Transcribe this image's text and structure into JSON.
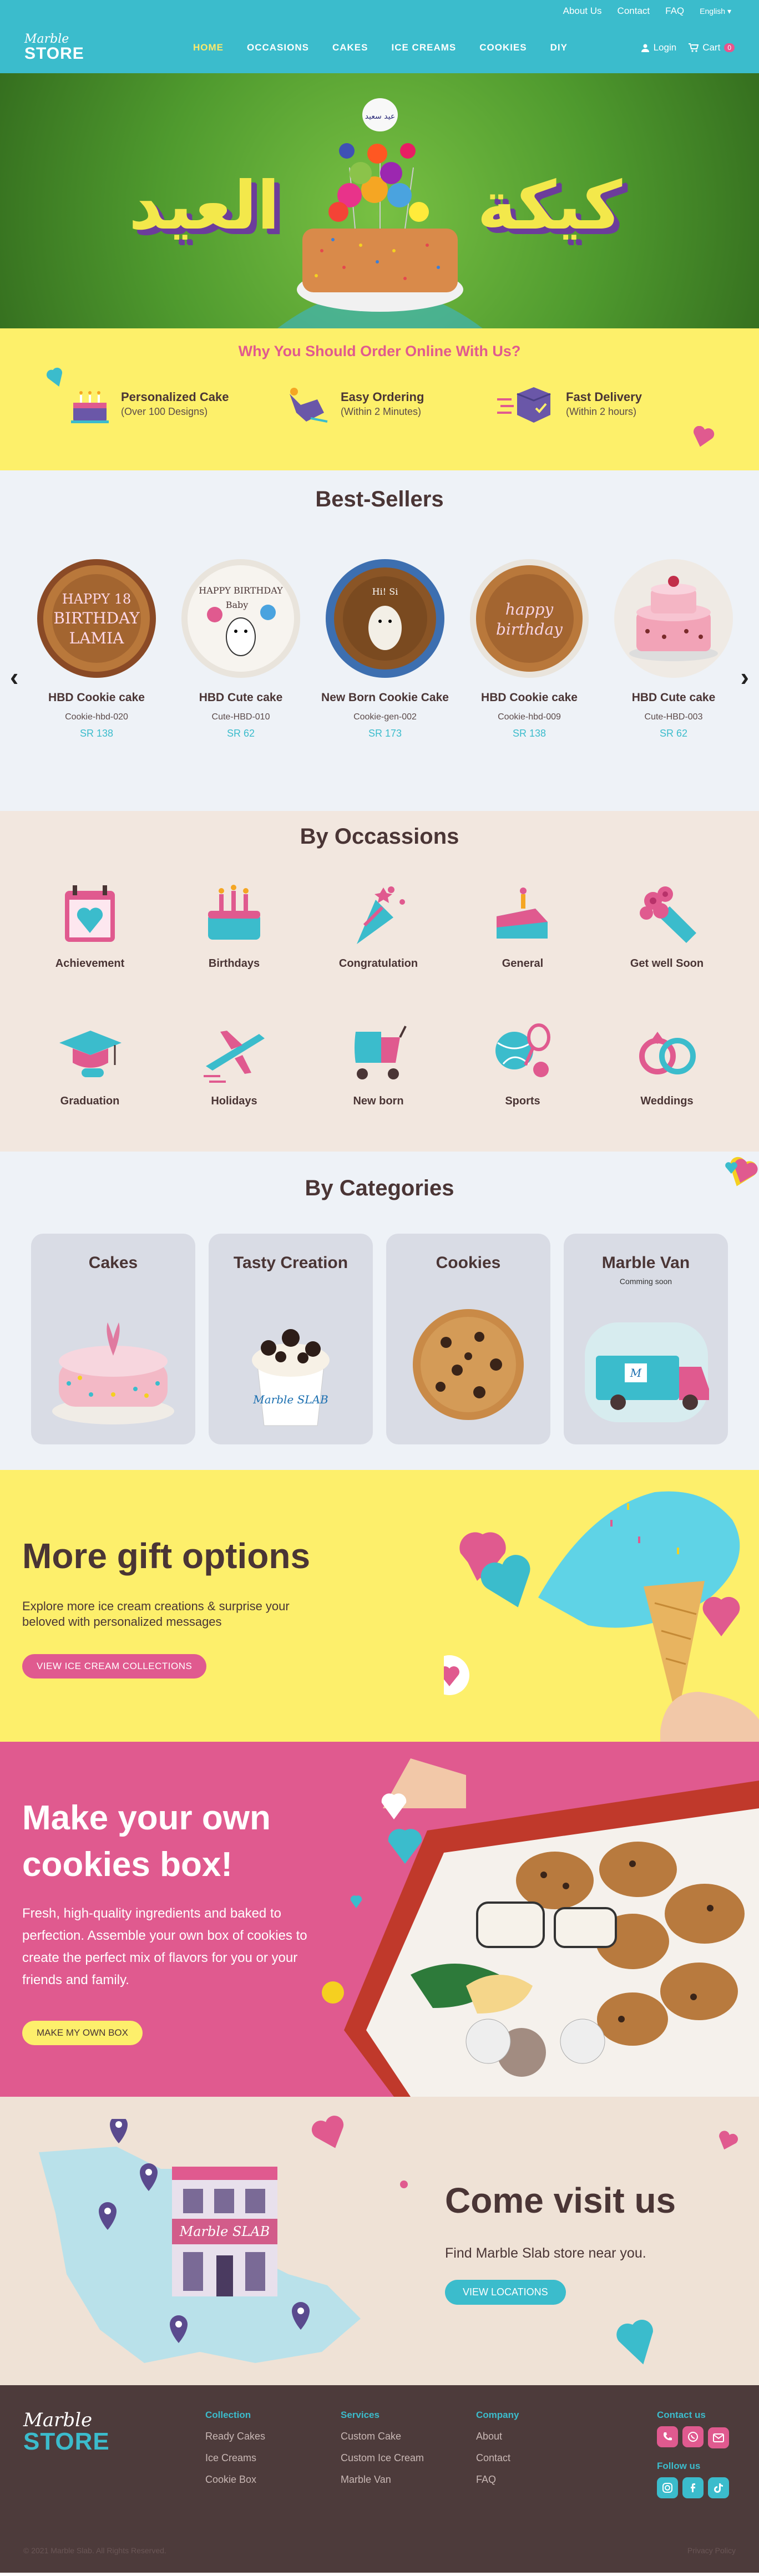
{
  "topbar": {
    "about": "About Us",
    "contact": "Contact",
    "faq": "FAQ",
    "lang": "English ▾"
  },
  "brand": {
    "script": "Marble",
    "name": "STORE"
  },
  "nav": {
    "items": [
      "HOME",
      "OCCASIONS",
      "CAKES",
      "ICE CREAMS",
      "COOKIES",
      "DIY"
    ],
    "login": "Login",
    "cart": "Cart",
    "cart_count": "0"
  },
  "hero": {
    "left_text": "العيد",
    "right_text": "كيكة",
    "topper": "عيد سعيد"
  },
  "why": {
    "title": "Why You Should Order Online With Us?",
    "features": [
      {
        "title": "Personalized Cake",
        "desc": "(Over 100 Designs)"
      },
      {
        "title": "Easy Ordering",
        "desc": "(Within 2 Minutes)"
      },
      {
        "title": "Fast Delivery",
        "desc": "(Within 2 hours)"
      }
    ]
  },
  "best": {
    "title": "Best-Sellers",
    "prev": "‹",
    "next": "›",
    "items": [
      {
        "name": "HBD Cookie cake",
        "code": "Cookie-hbd-020",
        "price": "SR 138",
        "inscription": "HAPPY 18 BIRTHDAY LAMIA"
      },
      {
        "name": "HBD Cute cake",
        "code": "Cute-HBD-010",
        "price": "SR 62",
        "inscription": "HAPPY BIRTHDAY Baby"
      },
      {
        "name": "New Born Cookie Cake",
        "code": "Cookie-gen-002",
        "price": "SR 173",
        "inscription": "Hi! Si"
      },
      {
        "name": "HBD Cookie cake",
        "code": "Cookie-hbd-009",
        "price": "SR 138",
        "inscription": "happy birthday"
      },
      {
        "name": "HBD Cute cake",
        "code": "Cute-HBD-003",
        "price": "SR 62",
        "inscription": ""
      }
    ]
  },
  "occasions": {
    "title": "By Occassions",
    "items": [
      "Achievement",
      "Birthdays",
      "Congratulation",
      "General",
      "Get well Soon",
      "Graduation",
      "Holidays",
      "New born",
      "Sports",
      "Weddings"
    ]
  },
  "categories": {
    "title": "By Categories",
    "items": [
      {
        "name": "Cakes",
        "sub": ""
      },
      {
        "name": "Tasty Creation",
        "sub": ""
      },
      {
        "name": "Cookies",
        "sub": ""
      },
      {
        "name": "Marble Van",
        "sub": "Comming soon"
      }
    ],
    "cup_label": "Marble SLAB"
  },
  "gift": {
    "title": "More gift options",
    "desc": "Explore more ice cream creations & surprise your beloved with personalized messages",
    "button": "VIEW ICE CREAM COLLECTIONS"
  },
  "cookies": {
    "title": "Make your own cookies box!",
    "desc": "Fresh, high-quality ingredients and baked to perfection. Assemble your own box of cookies to create the perfect mix of flavors for you or your friends and family.",
    "button": "MAKE MY OWN BOX"
  },
  "visit": {
    "title": "Come visit us",
    "desc": "Find Marble Slab store near you.",
    "button": "VIEW LOCATIONS",
    "store_sign": "Marble SLAB"
  },
  "footer": {
    "collection": {
      "title": "Collection",
      "links": [
        "Ready Cakes",
        "Ice Creams",
        "Cookie Box"
      ]
    },
    "services": {
      "title": "Services",
      "links": [
        "Custom Cake",
        "Custom Ice Cream",
        "Marble Van"
      ]
    },
    "company": {
      "title": "Company",
      "links": [
        "About",
        "Contact",
        "FAQ"
      ]
    },
    "contact_title": "Contact us",
    "follow_title": "Follow us",
    "copyright": "© 2021 Marble Slab. All Rights Reserved.",
    "privacy": "Privacy Policy"
  },
  "colors": {
    "teal": "#3bbccc",
    "pink": "#e05a8f",
    "yellow": "#fdef6b",
    "brown": "#4a3535"
  }
}
